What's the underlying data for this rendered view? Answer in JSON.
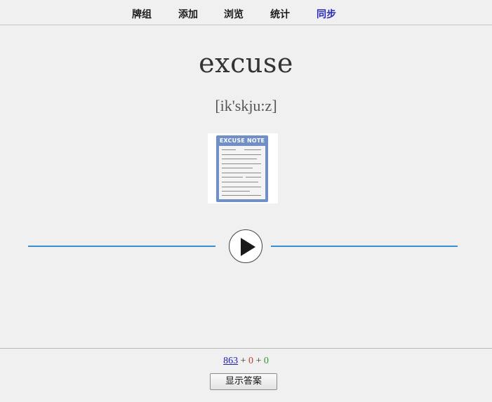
{
  "nav": {
    "items": [
      {
        "label": "牌组"
      },
      {
        "label": "添加"
      },
      {
        "label": "浏览"
      },
      {
        "label": "统计"
      },
      {
        "label": "同步"
      }
    ],
    "active_index": 4,
    "active_color": "#2a2ab8"
  },
  "card": {
    "word": "excuse",
    "phonetic": "[ik'skju:z]",
    "image_label": "EXCUSE NOTE",
    "audio_line_color": "#3a8fd0"
  },
  "footer": {
    "count_new": "863",
    "sep1": " + ",
    "count_learn": "0",
    "sep2": " + ",
    "count_review": "0",
    "show_answer_label": "显示答案"
  },
  "icons": {
    "play": "play-icon"
  }
}
